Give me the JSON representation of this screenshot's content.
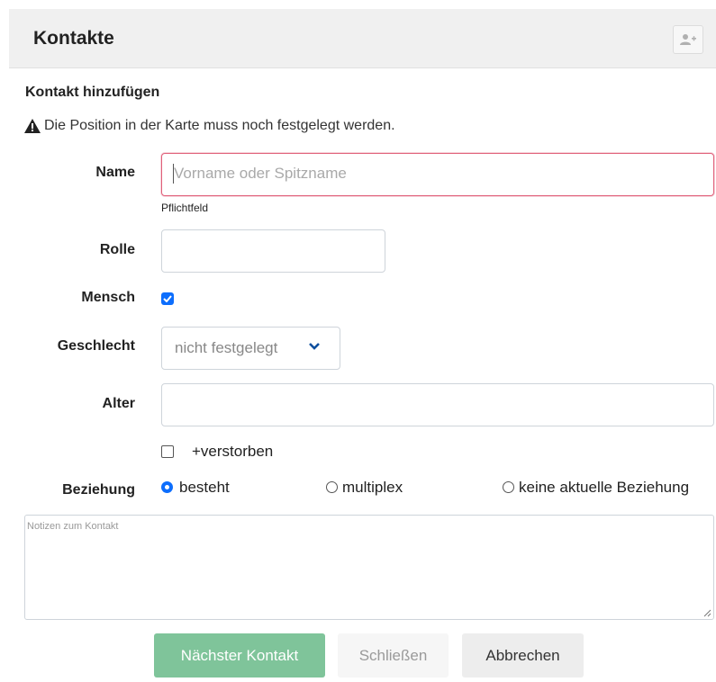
{
  "panel": {
    "title": "Kontakte",
    "add_button_icon": "user-plus-icon"
  },
  "form": {
    "section_title": "Kontakt hinzufügen",
    "warning_icon": "warning-triangle-icon",
    "warning_text": "Die Position in der Karte muss noch festgelegt werden.",
    "name": {
      "label": "Name",
      "placeholder": "Vorname oder Spitzname",
      "value": "",
      "help": "Pflichtfeld"
    },
    "rolle": {
      "label": "Rolle",
      "value": ""
    },
    "mensch": {
      "label": "Mensch",
      "checked": true
    },
    "geschlecht": {
      "label": "Geschlecht",
      "selected": "nicht festgelegt"
    },
    "alter": {
      "label": "Alter",
      "value": ""
    },
    "verstorben": {
      "label": "+verstorben",
      "checked": false
    },
    "beziehung": {
      "label": "Beziehung",
      "options": [
        {
          "label": "besteht",
          "selected": true
        },
        {
          "label": "multiplex",
          "selected": false
        },
        {
          "label": "keine aktuelle Beziehung",
          "selected": false
        }
      ]
    },
    "notizen": {
      "placeholder": "Notizen zum Kontakt",
      "value": ""
    }
  },
  "buttons": {
    "next": "Nächster Kontakt",
    "close": "Schließen",
    "cancel": "Abbrechen"
  },
  "colors": {
    "primary": "#0d6efd",
    "success_disabled": "#7fc49a",
    "invalid_border": "#e0607a"
  }
}
